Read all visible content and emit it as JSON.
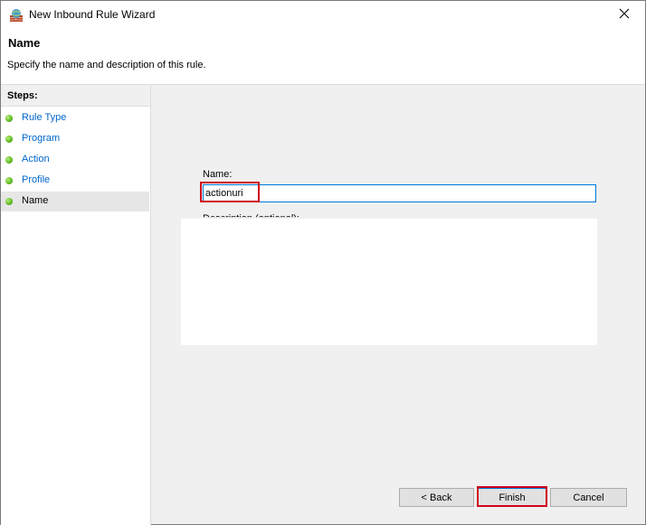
{
  "window": {
    "title": "New Inbound Rule Wizard",
    "icon": "firewall-icon",
    "close_icon": "close-icon"
  },
  "header": {
    "title": "Name",
    "subtitle": "Specify the name and description of this rule."
  },
  "steps": {
    "title": "Steps:",
    "items": [
      {
        "label": "Rule Type",
        "active": false
      },
      {
        "label": "Program",
        "active": false
      },
      {
        "label": "Action",
        "active": false
      },
      {
        "label": "Profile",
        "active": false
      },
      {
        "label": "Name",
        "active": true
      }
    ]
  },
  "form": {
    "name_label": "Name:",
    "name_value": "actionuri",
    "description_label": "Description (optional):",
    "description_value": ""
  },
  "buttons": {
    "back": "< Back",
    "finish": "Finish",
    "cancel": "Cancel"
  },
  "colors": {
    "highlight": "#d0021b",
    "link": "#0066cc",
    "focus": "#0078d7"
  }
}
